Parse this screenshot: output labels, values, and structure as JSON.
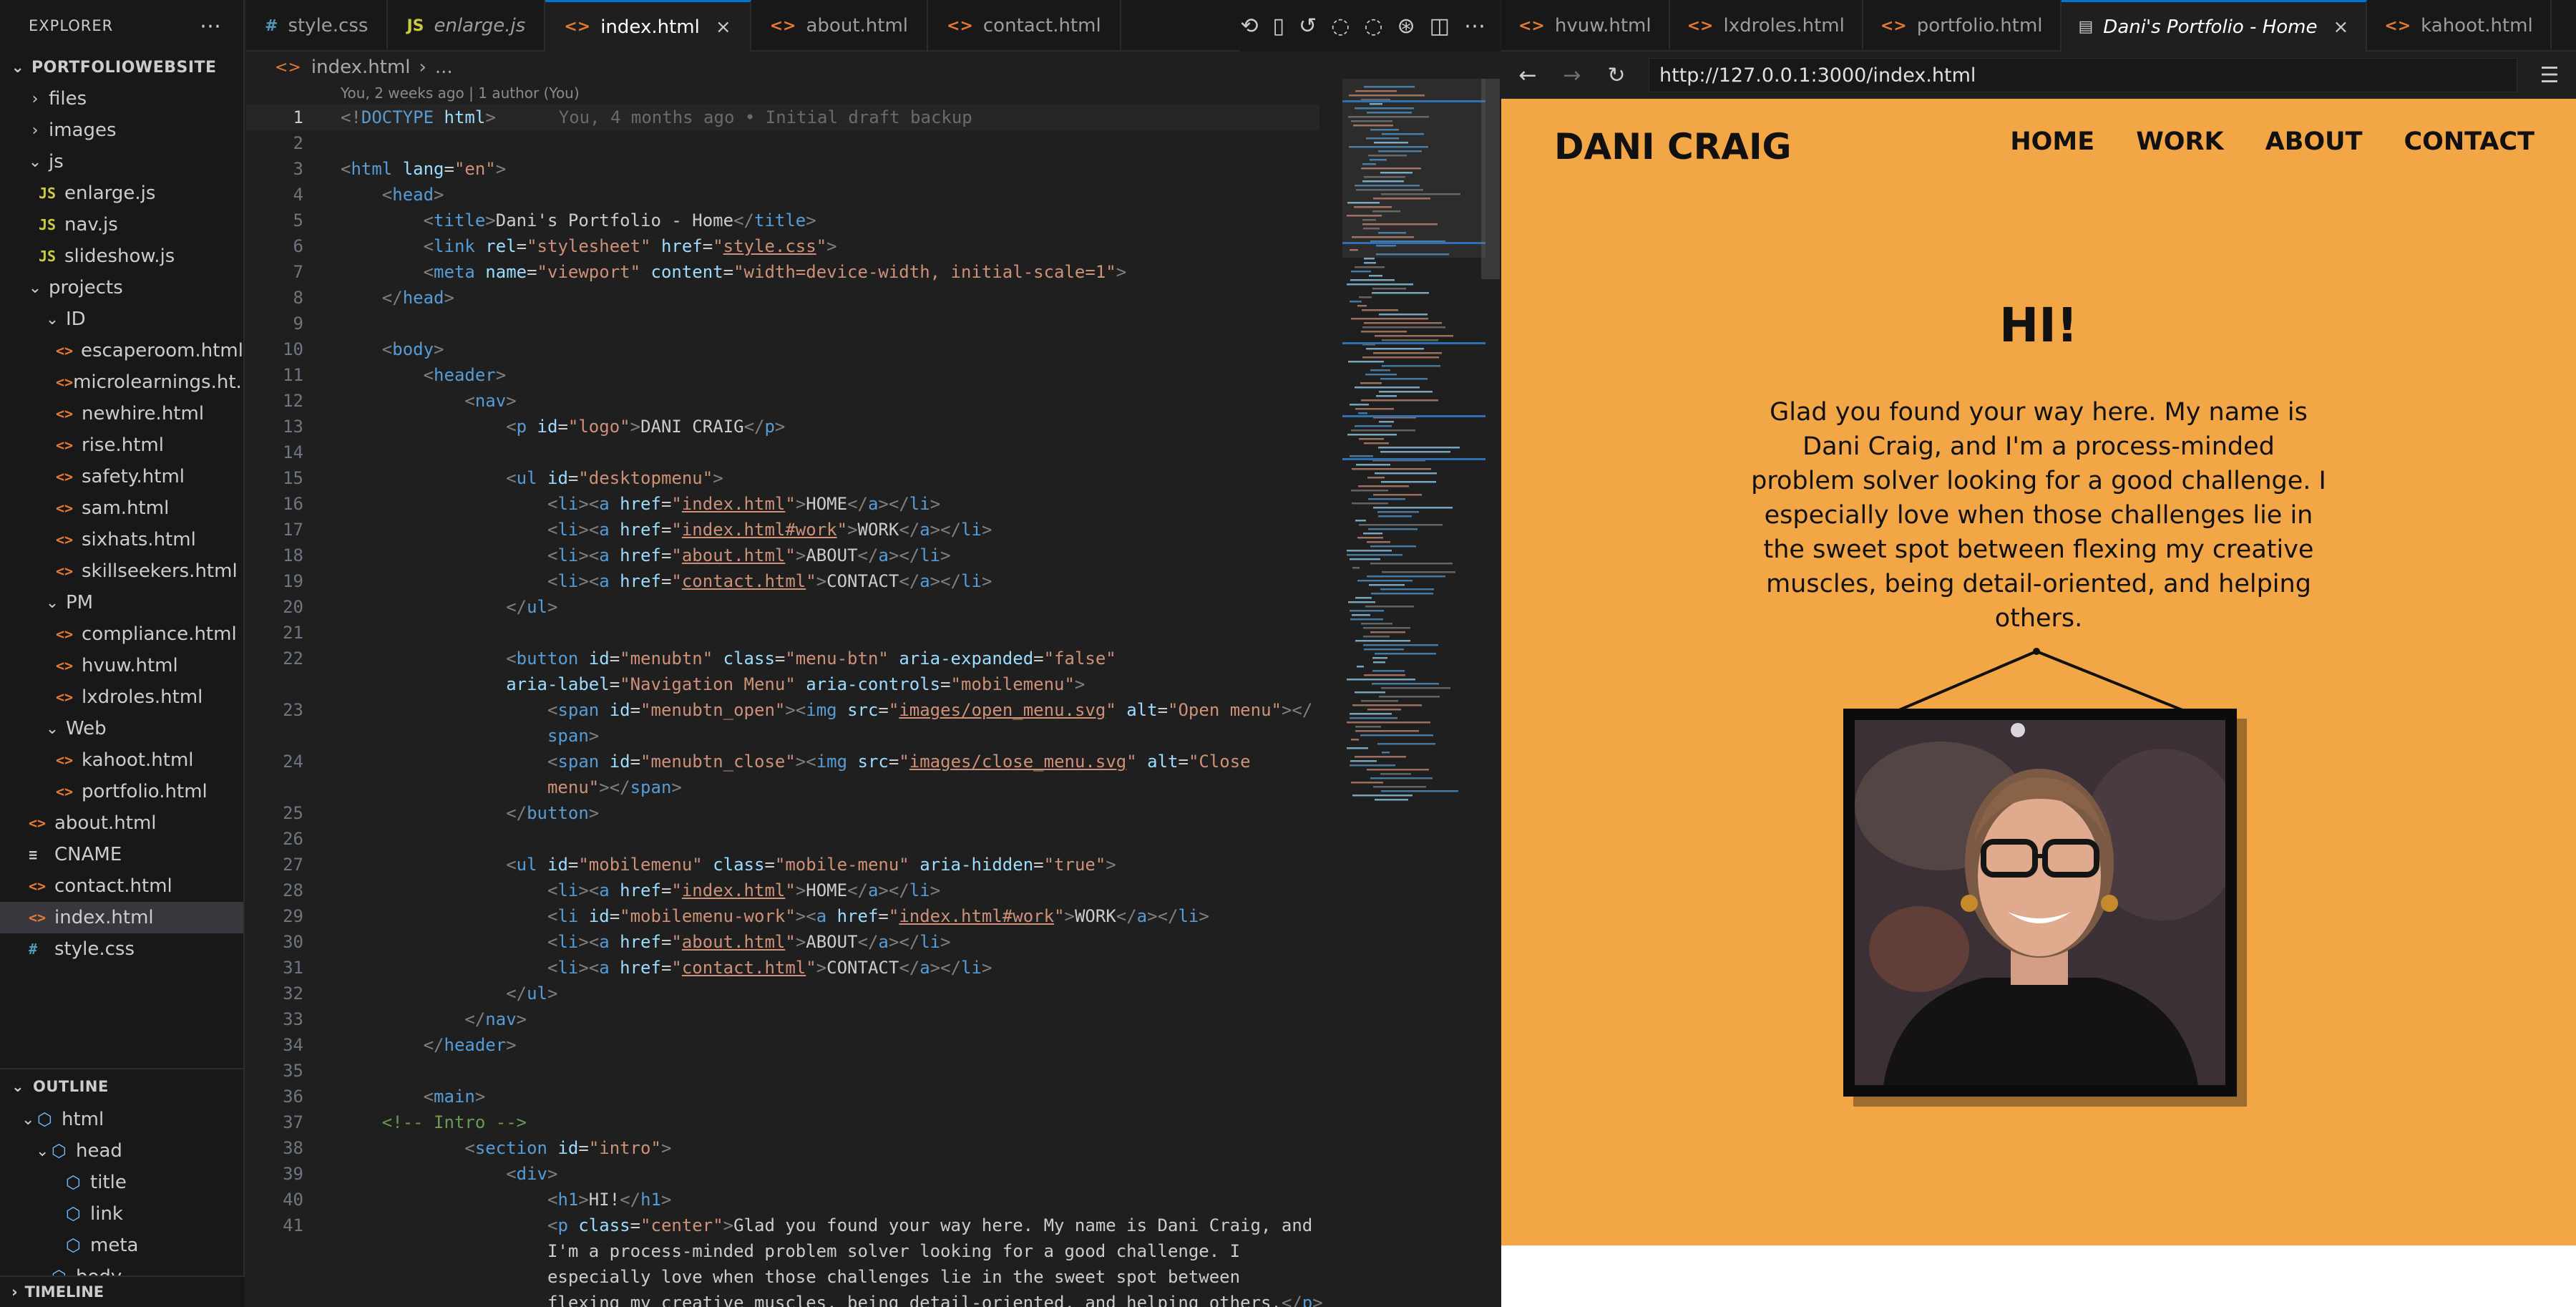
{
  "explorer": {
    "title": "EXPLORER",
    "root": "PORTFOLIOWEBSITE",
    "tree": [
      {
        "label": "files",
        "type": "folder",
        "open": false,
        "depth": 1
      },
      {
        "label": "images",
        "type": "folder",
        "open": false,
        "depth": 1
      },
      {
        "label": "js",
        "type": "folder",
        "open": true,
        "depth": 1
      },
      {
        "label": "enlarge.js",
        "type": "js",
        "depth": 2
      },
      {
        "label": "nav.js",
        "type": "js",
        "depth": 2
      },
      {
        "label": "slideshow.js",
        "type": "js",
        "depth": 2
      },
      {
        "label": "projects",
        "type": "folder",
        "open": true,
        "depth": 1
      },
      {
        "label": "ID",
        "type": "folder",
        "open": true,
        "depth": 2
      },
      {
        "label": "escaperoom.html",
        "type": "html",
        "depth": 3
      },
      {
        "label": "microlearnings.ht...",
        "type": "html",
        "depth": 3
      },
      {
        "label": "newhire.html",
        "type": "html",
        "depth": 3
      },
      {
        "label": "rise.html",
        "type": "html",
        "depth": 3
      },
      {
        "label": "safety.html",
        "type": "html",
        "depth": 3
      },
      {
        "label": "sam.html",
        "type": "html",
        "depth": 3
      },
      {
        "label": "sixhats.html",
        "type": "html",
        "depth": 3
      },
      {
        "label": "skillseekers.html",
        "type": "html",
        "depth": 3
      },
      {
        "label": "PM",
        "type": "folder",
        "open": true,
        "depth": 2
      },
      {
        "label": "compliance.html",
        "type": "html",
        "depth": 3
      },
      {
        "label": "hvuw.html",
        "type": "html",
        "depth": 3
      },
      {
        "label": "lxdroles.html",
        "type": "html",
        "depth": 3
      },
      {
        "label": "Web",
        "type": "folder",
        "open": true,
        "depth": 2
      },
      {
        "label": "kahoot.html",
        "type": "html",
        "depth": 3
      },
      {
        "label": "portfolio.html",
        "type": "html",
        "depth": 3
      },
      {
        "label": "about.html",
        "type": "html",
        "depth": 1
      },
      {
        "label": "CNAME",
        "type": "cname",
        "depth": 1
      },
      {
        "label": "contact.html",
        "type": "html",
        "depth": 1
      },
      {
        "label": "index.html",
        "type": "html",
        "depth": 1,
        "active": true
      },
      {
        "label": "style.css",
        "type": "css",
        "depth": 1
      }
    ]
  },
  "outline": {
    "title": "OUTLINE",
    "items": [
      {
        "label": "html",
        "depth": 1
      },
      {
        "label": "head",
        "depth": 2
      },
      {
        "label": "title",
        "depth": 3
      },
      {
        "label": "link",
        "depth": 3
      },
      {
        "label": "meta",
        "depth": 3
      },
      {
        "label": "body",
        "depth": 2
      }
    ]
  },
  "timeline": {
    "title": "TIMELINE"
  },
  "editor": {
    "tabs": [
      {
        "label": "style.css",
        "icon": "#",
        "type": "css"
      },
      {
        "label": "enlarge.js",
        "icon": "JS",
        "type": "js",
        "italic": true
      },
      {
        "label": "index.html",
        "icon": "<>",
        "type": "html",
        "active": true
      },
      {
        "label": "about.html",
        "icon": "<>",
        "type": "html"
      },
      {
        "label": "contact.html",
        "icon": "<>",
        "type": "html"
      }
    ],
    "breadcrumb": [
      "index.html",
      "..."
    ],
    "blame_header": "You, 2 weeks ago | 1 author (You)",
    "line1_blame": "You, 4 months ago • Initial draft backup",
    "current_line": 1
  },
  "browser": {
    "tabs": [
      {
        "label": "hvuw.html",
        "type": "html"
      },
      {
        "label": "lxdroles.html",
        "type": "html"
      },
      {
        "label": "portfolio.html",
        "type": "html"
      },
      {
        "label": "Dani's Portfolio - Home",
        "type": "page",
        "active": true
      },
      {
        "label": "kahoot.html",
        "type": "html"
      }
    ],
    "url": "http://127.0.0.1:3000/index.html"
  },
  "site": {
    "logo": "DANI CRAIG",
    "nav": [
      "HOME",
      "WORK",
      "ABOUT",
      "CONTACT"
    ],
    "heading": "HI!",
    "intro": "Glad you found your way here. My name is Dani Craig, and I'm a process-minded problem solver looking for a good challenge. I especially love when those challenges lie in the sweet spot between flexing my creative muscles, being detail-oriented, and helping others.",
    "background_color": "#f3a646"
  },
  "colors": {
    "accent": "#0078d4",
    "tag": "#569cd6",
    "attr": "#9cdcfe",
    "string": "#ce9178",
    "comment": "#6a9955"
  }
}
